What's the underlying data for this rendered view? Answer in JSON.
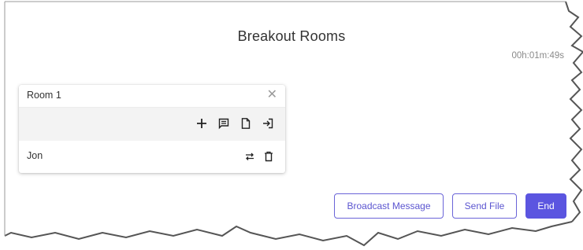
{
  "dialog": {
    "title": "Breakout Rooms",
    "timer": "00h:01m:49s"
  },
  "room": {
    "name": "Room 1",
    "close_icon": "close-icon",
    "toolbar_icons": [
      "add-icon",
      "chat-icon",
      "file-icon",
      "join-icon"
    ],
    "members": [
      {
        "name": "Jon",
        "icons": [
          "move-icon",
          "delete-icon"
        ]
      }
    ]
  },
  "actions": {
    "broadcast_label": "Broadcast Message",
    "send_file_label": "Send File",
    "end_label": "End"
  },
  "colors": {
    "accent": "#5b55e0",
    "toolbar_bg": "#f3f3f3",
    "timer_text": "#8a8a8a"
  }
}
